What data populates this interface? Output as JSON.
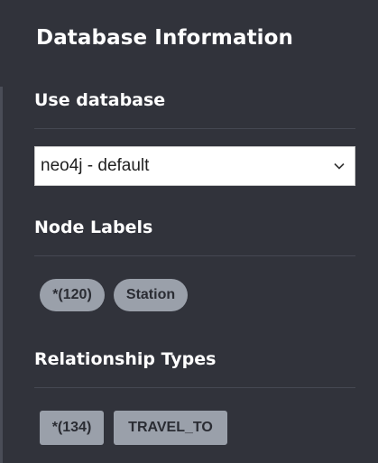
{
  "panel": {
    "title": "Database Information"
  },
  "use_database": {
    "heading": "Use database",
    "selected": "neo4j - default"
  },
  "node_labels": {
    "heading": "Node Labels",
    "items": [
      {
        "label": "*(120)"
      },
      {
        "label": "Station"
      }
    ]
  },
  "relationship_types": {
    "heading": "Relationship Types",
    "items": [
      {
        "label": "*(134)"
      },
      {
        "label": "TRAVEL_TO"
      }
    ]
  },
  "colors": {
    "background": "#31333b",
    "pill": "#9aa0aa",
    "text": "#ffffff"
  },
  "icons": {
    "select": "chevron-down-icon"
  }
}
